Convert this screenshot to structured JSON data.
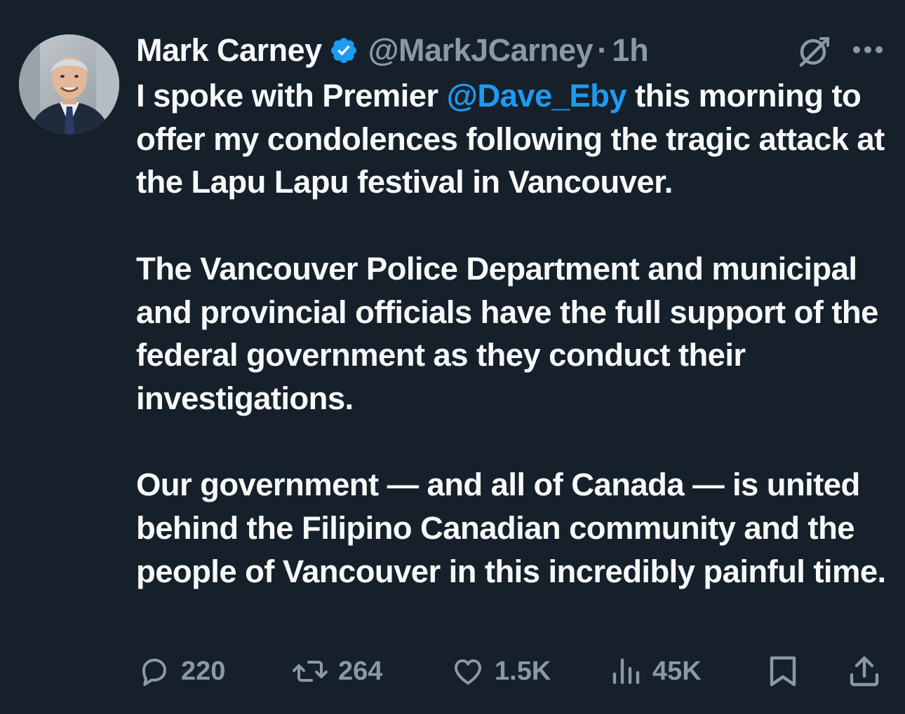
{
  "author": {
    "display_name": "Mark Carney",
    "handle": "@MarkJCarney",
    "separator": "·",
    "time": "1h",
    "verified_color": "#1d9bf0"
  },
  "tweet": {
    "p1_before": "I spoke with Premier ",
    "p1_mention": "@Dave_Eby",
    "p1_after": " this morning to offer my condolences following the tragic attack at the Lapu Lapu festival in Vancouver.",
    "p2": "The Vancouver Police Department and municipal and provincial officials have the full support of the federal government as they conduct their investigations.",
    "p3": "Our government — and all of Canada — is united behind the Filipino Canadian community and the people of Vancouver in this incredibly painful time."
  },
  "stats": {
    "replies": "220",
    "reposts": "264",
    "likes": "1.5K",
    "views": "45K"
  },
  "icons": {
    "reply": "reply-icon",
    "repost": "repost-icon",
    "like": "heart-icon",
    "views": "views-icon",
    "bookmark": "bookmark-icon",
    "share": "share-icon",
    "grok": "grok-icon",
    "more": "more-icon"
  },
  "colors": {
    "background": "#15202b",
    "text": "#f7f9f9",
    "muted": "#8b98a5",
    "accent": "#1d9bf0"
  }
}
